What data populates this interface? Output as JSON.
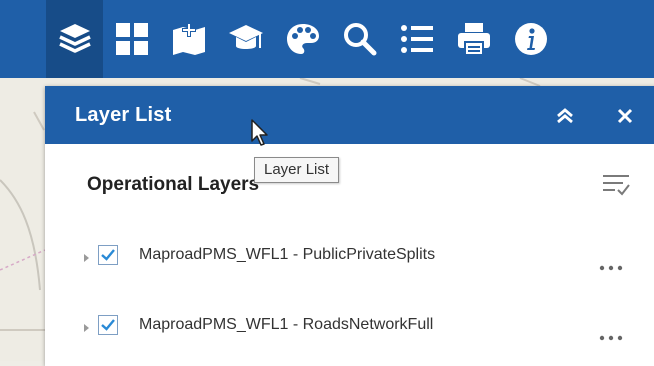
{
  "toolbar": {
    "tools": [
      {
        "icon": "layers-icon",
        "active": true
      },
      {
        "icon": "grid-icon",
        "active": false
      },
      {
        "icon": "bookmark-add-icon",
        "active": false
      },
      {
        "icon": "graduation-cap-icon",
        "active": false
      },
      {
        "icon": "palette-icon",
        "active": false
      },
      {
        "icon": "search-icon",
        "active": false
      },
      {
        "icon": "list-icon",
        "active": false
      },
      {
        "icon": "print-icon",
        "active": false
      },
      {
        "icon": "info-icon",
        "active": false
      }
    ]
  },
  "panel": {
    "title": "Layer List",
    "collapse_icon": "chevron-double-up-icon",
    "close_icon": "close-icon",
    "section_title": "Operational Layers",
    "filter_icon": "filter-list-icon",
    "layers": [
      {
        "name": "MaproadPMS_WFL1 - PublicPrivateSplits",
        "checked": true
      },
      {
        "name": "MaproadPMS_WFL1 - RoadsNetworkFull",
        "checked": true
      }
    ]
  },
  "tooltip": {
    "text": "Layer List"
  },
  "colors": {
    "header_blue": "#1f5fa8",
    "active_tool": "#174c88",
    "checkbox_blue": "#2a8ad6"
  }
}
